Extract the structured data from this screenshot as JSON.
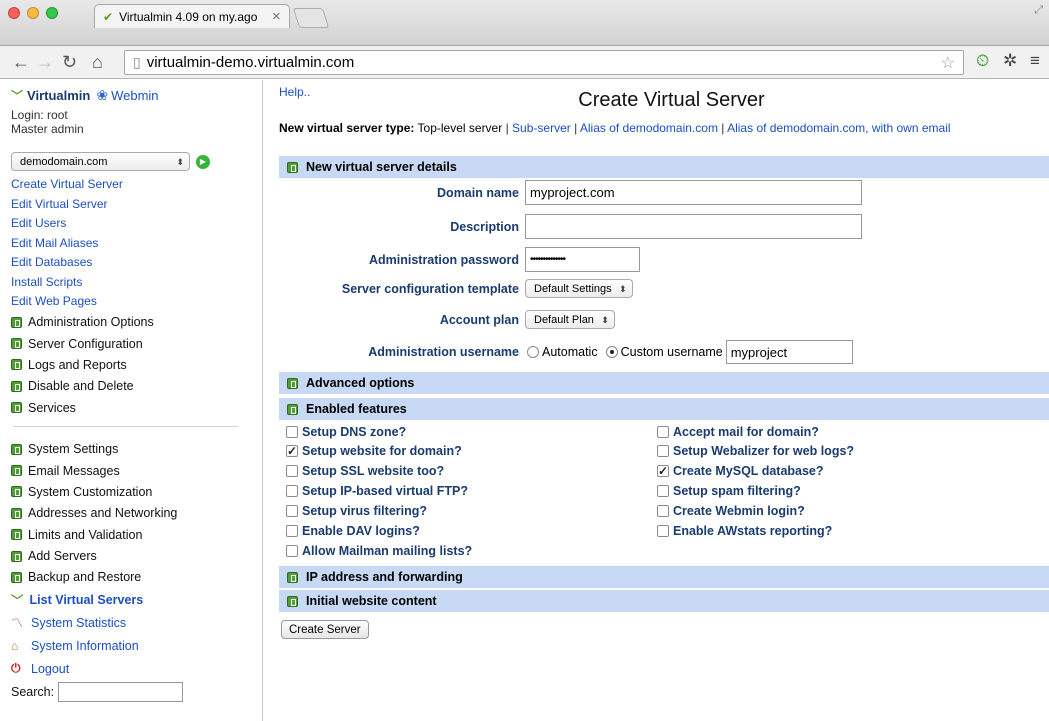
{
  "browser": {
    "tab_title": "Virtualmin 4.09 on my.ago",
    "url": "virtualmin-demo.virtualmin.com"
  },
  "sidebar": {
    "brand_virtualmin": "Virtualmin",
    "brand_webmin": "Webmin",
    "login_line": "Login: root",
    "role_line": "Master admin",
    "domain_select": "demodomain.com",
    "links": [
      "Create Virtual Server",
      "Edit Virtual Server",
      "Edit Users",
      "Edit Mail Aliases",
      "Edit Databases",
      "Install Scripts",
      "Edit Web Pages"
    ],
    "categories_top": [
      "Administration Options",
      "Server Configuration",
      "Logs and Reports",
      "Disable and Delete",
      "Services"
    ],
    "categories_bottom": [
      "System Settings",
      "Email Messages",
      "System Customization",
      "Addresses and Networking",
      "Limits and Validation",
      "Add Servers",
      "Backup and Restore"
    ],
    "list_virtual_servers": "List Virtual Servers",
    "system_statistics": "System Statistics",
    "system_information": "System Information",
    "logout": "Logout",
    "search_label": "Search:",
    "search_value": ""
  },
  "main": {
    "help": "Help..",
    "title": "Create Virtual Server",
    "type_label": "New virtual server type:",
    "type_current": "Top-level server",
    "type_links": [
      "Sub-server",
      "Alias of demodomain.com",
      "Alias of demodomain.com, with own email"
    ],
    "sections": {
      "details": "New virtual server details",
      "advanced": "Advanced options",
      "features": "Enabled features",
      "ip": "IP address and forwarding",
      "content": "Initial website content"
    },
    "fields": {
      "domain_name_label": "Domain name",
      "domain_name_value": "myproject.com",
      "description_label": "Description",
      "description_value": "",
      "password_label": "Administration password",
      "password_value": "••••••••••••••",
      "template_label": "Server configuration template",
      "template_value": "Default Settings",
      "plan_label": "Account plan",
      "plan_value": "Default Plan",
      "username_label": "Administration username",
      "username_auto": "Automatic",
      "username_custom": "Custom username",
      "username_value": "myproject",
      "username_mode": "custom"
    },
    "features_left": [
      {
        "label": "Setup DNS zone?",
        "checked": false
      },
      {
        "label": "Setup website for domain?",
        "checked": true
      },
      {
        "label": "Setup SSL website too?",
        "checked": false
      },
      {
        "label": "Setup IP-based virtual FTP?",
        "checked": false
      },
      {
        "label": "Setup virus filtering?",
        "checked": false
      },
      {
        "label": "Enable DAV logins?",
        "checked": false
      },
      {
        "label": "Allow Mailman mailing lists?",
        "checked": false
      }
    ],
    "features_right": [
      {
        "label": "Accept mail for domain?",
        "checked": false
      },
      {
        "label": "Setup Webalizer for web logs?",
        "checked": false
      },
      {
        "label": "Create MySQL database?",
        "checked": true
      },
      {
        "label": "Setup spam filtering?",
        "checked": false
      },
      {
        "label": "Create Webmin login?",
        "checked": false
      },
      {
        "label": "Enable AWstats reporting?",
        "checked": false
      }
    ],
    "create_button": "Create Server"
  },
  "colors": {
    "link": "#1b4fc2",
    "section_bg": "#c7d9f5",
    "brand_green": "#62a527"
  }
}
